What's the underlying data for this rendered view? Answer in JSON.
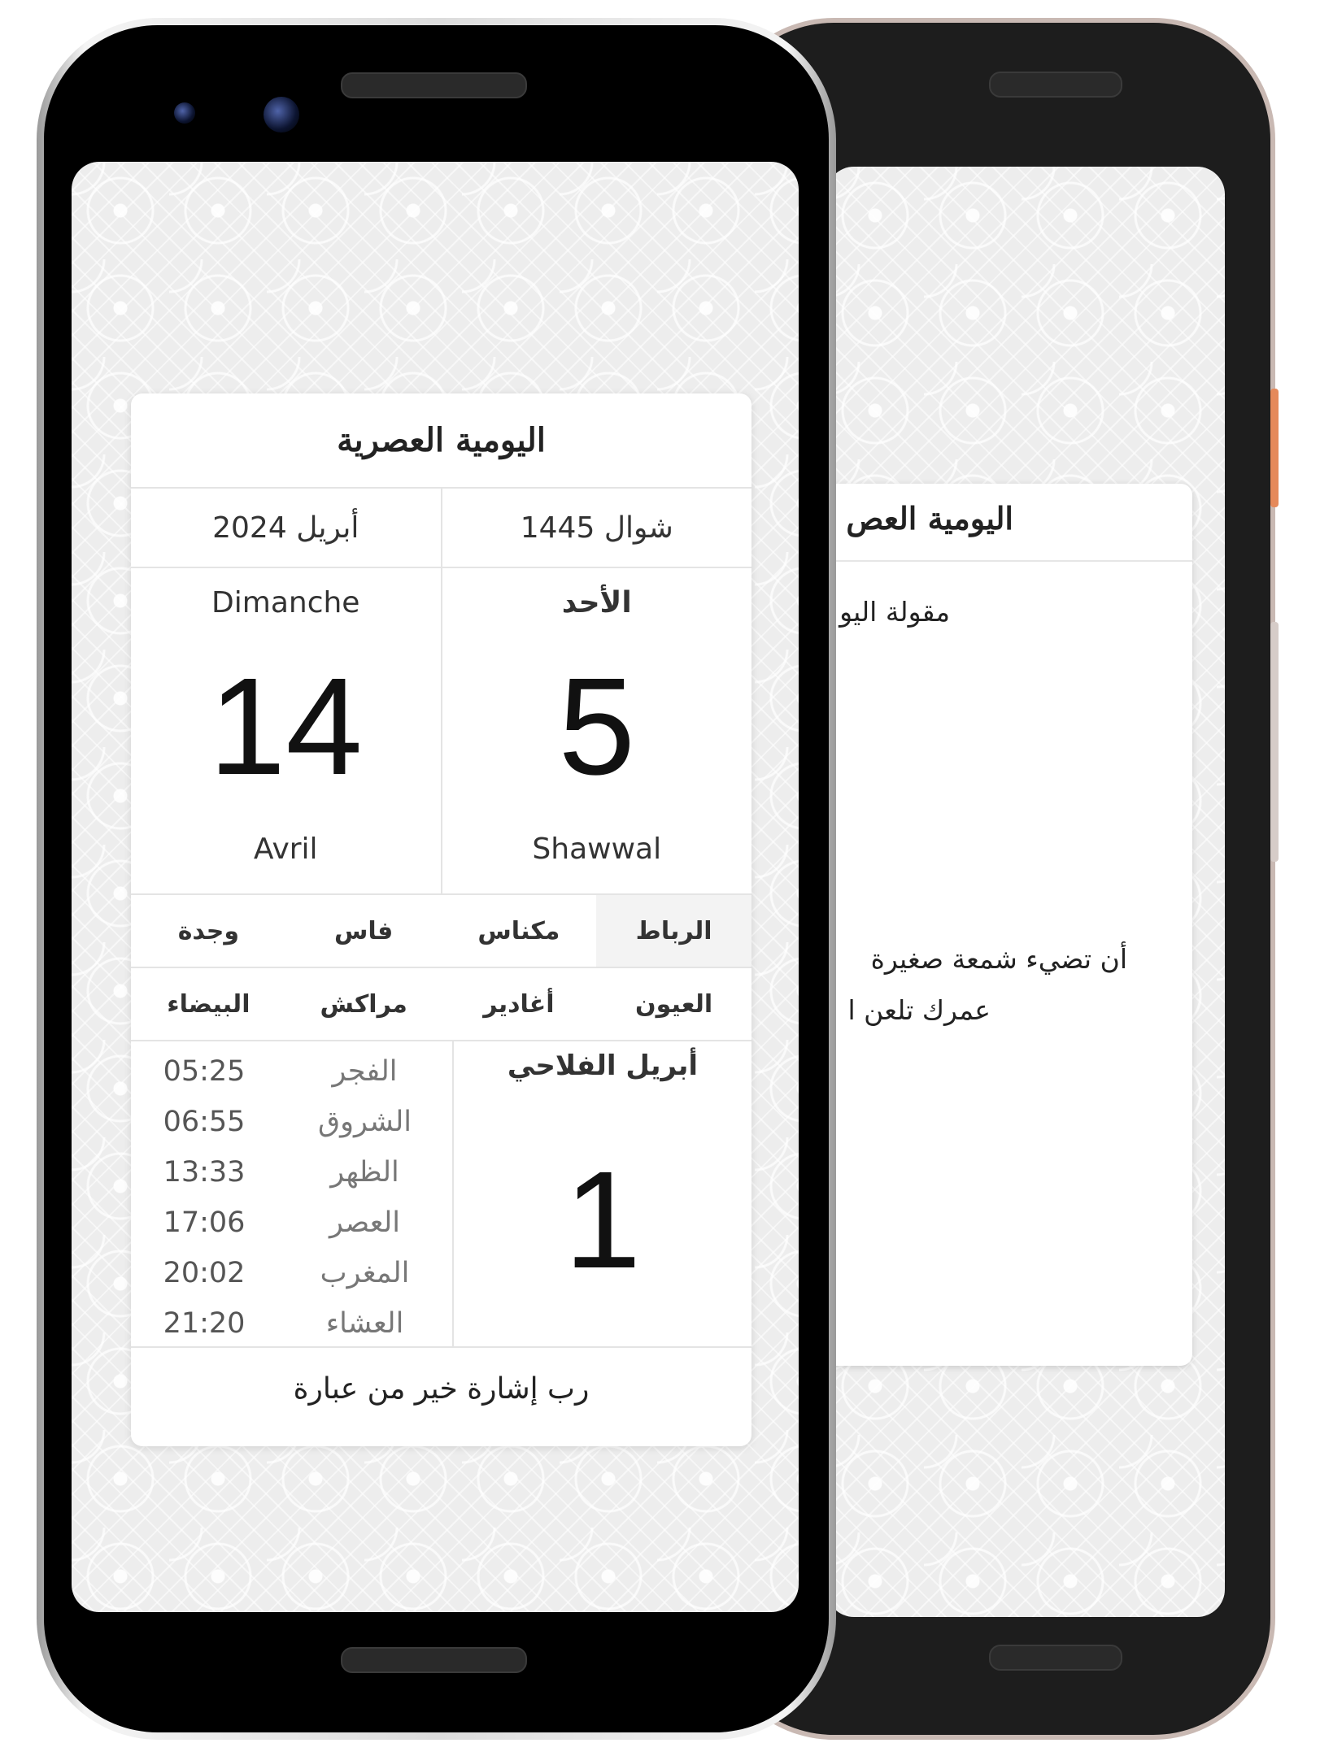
{
  "app": {
    "title": "اليومية العصرية"
  },
  "calendar": {
    "hijri_month_year": "شوال 1445",
    "gregorian_month_year": "أبريل 2024",
    "weekday_ar": "الأحد",
    "weekday_fr": "Dimanche",
    "hijri_day": "5",
    "gregorian_day": "14",
    "hijri_month_latin": "Shawwal",
    "gregorian_month_fr": "Avril"
  },
  "cities": [
    {
      "label": "الرباط",
      "active": true
    },
    {
      "label": "مكناس",
      "active": false
    },
    {
      "label": "فاس",
      "active": false
    },
    {
      "label": "وجدة",
      "active": false
    },
    {
      "label": "العيون",
      "active": false
    },
    {
      "label": "أغادير",
      "active": false
    },
    {
      "label": "مراكش",
      "active": false
    },
    {
      "label": "البيضاء",
      "active": false
    }
  ],
  "prayers": [
    {
      "name": "الفجر",
      "time": "05:25"
    },
    {
      "name": "الشروق",
      "time": "06:55"
    },
    {
      "name": "الظهر",
      "time": "13:33"
    },
    {
      "name": "العصر",
      "time": "17:06"
    },
    {
      "name": "المغرب",
      "time": "20:02"
    },
    {
      "name": "العشاء",
      "time": "21:20"
    }
  ],
  "farm_calendar": {
    "month": "أبريل الفلاحي",
    "day": "1"
  },
  "proverb": "رب إشارة خير من عبارة",
  "back_screen": {
    "title": "اليومية العص",
    "quote_label": "مقولة اليو",
    "quote_line1": "أن تضيء شمعة صغيرة",
    "quote_line2": "عمرك تلعن ا"
  },
  "colors": {
    "card_background": "#ffffff",
    "screen_background": "#ededed",
    "active_city_background": "#f3f3f3",
    "back_phone_accent": "#5fd6c0"
  }
}
